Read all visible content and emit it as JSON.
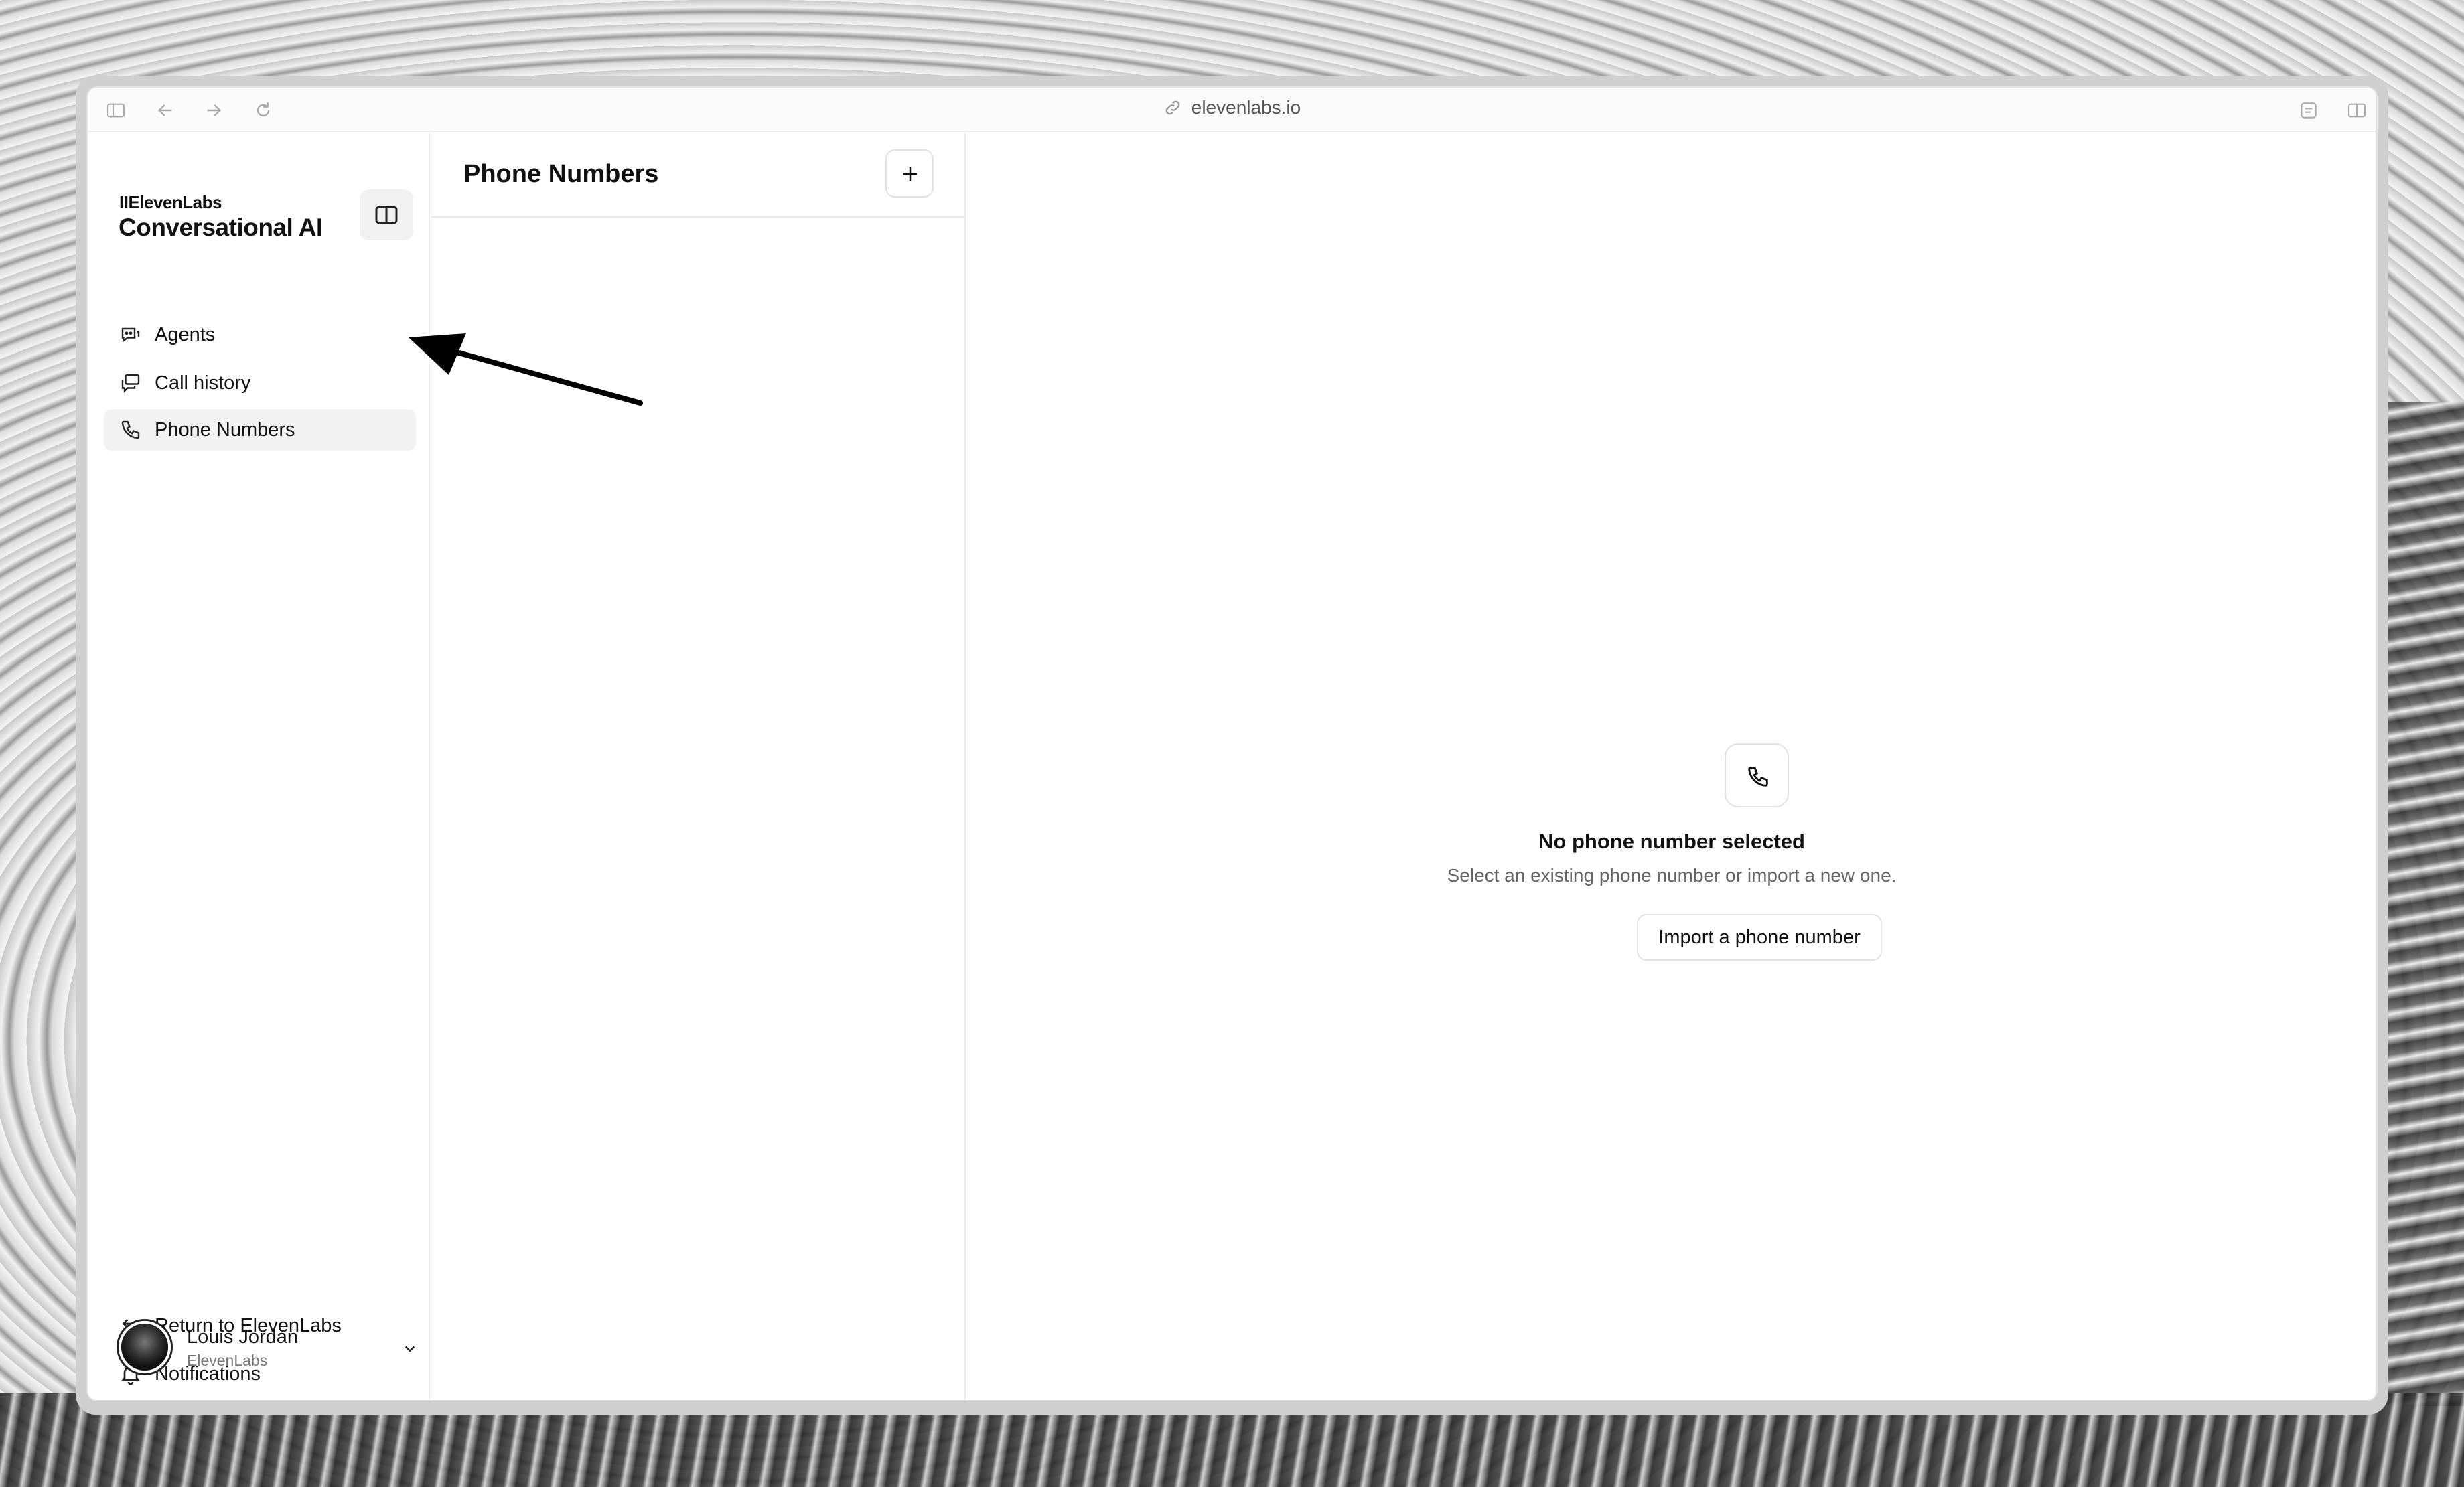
{
  "browser": {
    "url": "elevenlabs.io"
  },
  "sidebar": {
    "brand_small": "IIElevenLabs",
    "brand_title": "Conversational AI",
    "nav": [
      {
        "label": "Agents",
        "icon": "agent-chat-icon",
        "active": false
      },
      {
        "label": "Call history",
        "icon": "chat-bubbles-icon",
        "active": false
      },
      {
        "label": "Phone Numbers",
        "icon": "phone-icon",
        "active": true
      }
    ],
    "bottom": [
      {
        "label": "Return to ElevenLabs",
        "icon": "return-arrow-icon"
      },
      {
        "label": "Notifications",
        "icon": "bell-icon"
      }
    ],
    "user": {
      "name": "Louis Jordan",
      "org": "ElevenLabs"
    }
  },
  "middle": {
    "title": "Phone Numbers",
    "add_icon": "plus-icon"
  },
  "empty_state": {
    "icon": "phone-icon",
    "title": "No phone number selected",
    "description": "Select an existing phone number or import a new one.",
    "button_label": "Import a phone number"
  },
  "colors": {
    "active_nav_bg": "#f2f2f2",
    "border": "#ececec",
    "muted_text": "#666666"
  }
}
